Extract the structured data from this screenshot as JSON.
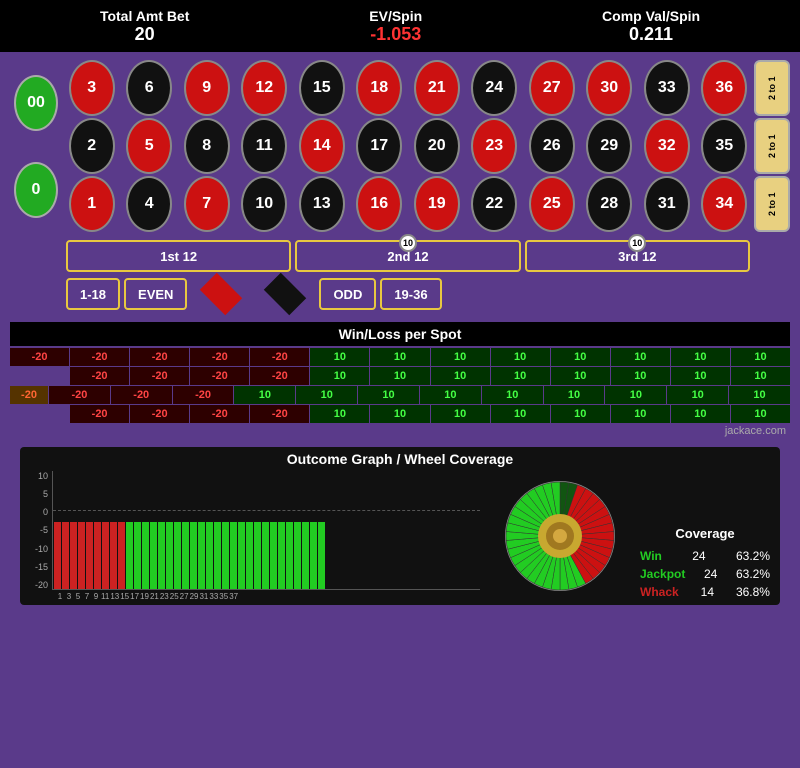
{
  "header": {
    "title1": "Total Amt Bet",
    "value1": "20",
    "title2": "EV/Spin",
    "value2": "-1.053",
    "title3": "Comp Val/Spin",
    "value3": "0.211"
  },
  "table": {
    "zeros": [
      "00",
      "0"
    ],
    "two_to_one": [
      "2 to 1",
      "2 to 1",
      "2 to 1"
    ],
    "numbers": [
      {
        "n": "3",
        "color": "red"
      },
      {
        "n": "6",
        "color": "black"
      },
      {
        "n": "9",
        "color": "red"
      },
      {
        "n": "12",
        "color": "red"
      },
      {
        "n": "15",
        "color": "black"
      },
      {
        "n": "18",
        "color": "red"
      },
      {
        "n": "21",
        "color": "red"
      },
      {
        "n": "24",
        "color": "black"
      },
      {
        "n": "27",
        "color": "red"
      },
      {
        "n": "30",
        "color": "red"
      },
      {
        "n": "33",
        "color": "black"
      },
      {
        "n": "36",
        "color": "red"
      },
      {
        "n": "2",
        "color": "black"
      },
      {
        "n": "5",
        "color": "red"
      },
      {
        "n": "8",
        "color": "black"
      },
      {
        "n": "11",
        "color": "black"
      },
      {
        "n": "14",
        "color": "red"
      },
      {
        "n": "17",
        "color": "black"
      },
      {
        "n": "20",
        "color": "black"
      },
      {
        "n": "23",
        "color": "red"
      },
      {
        "n": "26",
        "color": "black"
      },
      {
        "n": "29",
        "color": "black"
      },
      {
        "n": "32",
        "color": "red"
      },
      {
        "n": "35",
        "color": "black"
      },
      {
        "n": "1",
        "color": "red"
      },
      {
        "n": "4",
        "color": "black"
      },
      {
        "n": "7",
        "color": "red"
      },
      {
        "n": "10",
        "color": "black"
      },
      {
        "n": "13",
        "color": "black"
      },
      {
        "n": "16",
        "color": "red"
      },
      {
        "n": "19",
        "color": "red"
      },
      {
        "n": "22",
        "color": "black"
      },
      {
        "n": "25",
        "color": "red"
      },
      {
        "n": "28",
        "color": "black"
      },
      {
        "n": "31",
        "color": "black"
      },
      {
        "n": "34",
        "color": "red"
      }
    ]
  },
  "betting": {
    "dozen1": "1st 12",
    "dozen2_prefix": "2n",
    "dozen2_suffix": "12",
    "dozen2_chip": "10",
    "dozen3_prefix": "3r",
    "dozen3_suffix": "12",
    "dozen3_chip": "10",
    "low": "1-18",
    "even": "EVEN",
    "odd": "ODD",
    "high": "19-36"
  },
  "winloss": {
    "title": "Win/Loss per Spot",
    "rows": [
      [
        "-20",
        "-20",
        "-20",
        "-20",
        "-20",
        "10",
        "10",
        "10",
        "10",
        "10",
        "10",
        "10",
        "10"
      ],
      [
        "-20",
        "-20",
        "-20",
        "-20",
        "10",
        "10",
        "10",
        "10",
        "10",
        "10",
        "10",
        "10"
      ],
      [
        "-20",
        "-20",
        "-20",
        "-20",
        "10",
        "10",
        "10",
        "10",
        "10",
        "10",
        "10",
        "10"
      ],
      [
        "-20",
        "-20",
        "-20",
        "-20",
        "10",
        "10",
        "10",
        "10",
        "10",
        "10",
        "10",
        "10"
      ]
    ],
    "side_labels": [
      "-20"
    ],
    "credit": "jackace.com"
  },
  "outcome": {
    "title": "Outcome Graph / Wheel Coverage",
    "bars": {
      "neg_count": 9,
      "pos_count": 25,
      "neg_height": 100,
      "pos_height": 60,
      "labels": [
        "1",
        "3",
        "5",
        "7",
        "9",
        "11",
        "13",
        "15",
        "17",
        "19",
        "21",
        "23",
        "25",
        "27",
        "29",
        "31",
        "33",
        "35",
        "37"
      ]
    },
    "y_labels": [
      "10",
      "5",
      "0",
      "-5",
      "-10",
      "-15",
      "-20"
    ],
    "coverage": {
      "title": "Coverage",
      "win_label": "Win",
      "win_val": "24",
      "win_pct": "63.2%",
      "jackpot_label": "Jackpot",
      "jackpot_val": "24",
      "jackpot_pct": "63.2%",
      "whack_label": "Whack",
      "whack_val": "14",
      "whack_pct": "36.8%"
    }
  }
}
